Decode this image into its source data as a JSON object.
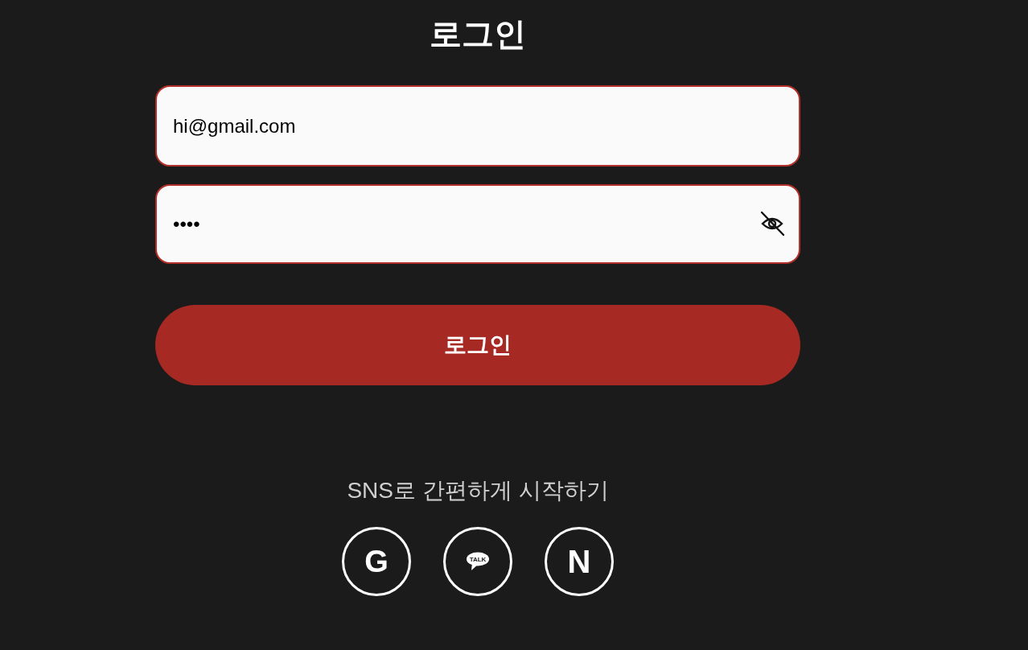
{
  "title": "로그인",
  "email": {
    "value": "hi@gmail.com"
  },
  "password": {
    "value": "••••",
    "visible": false
  },
  "login_button": {
    "label": "로그인"
  },
  "sns": {
    "caption": "SNS로 간편하게 시작하기",
    "buttons": [
      {
        "kind": "google",
        "label": "G"
      },
      {
        "kind": "kakao",
        "label": "TALK"
      },
      {
        "kind": "naver",
        "label": "N"
      }
    ]
  }
}
